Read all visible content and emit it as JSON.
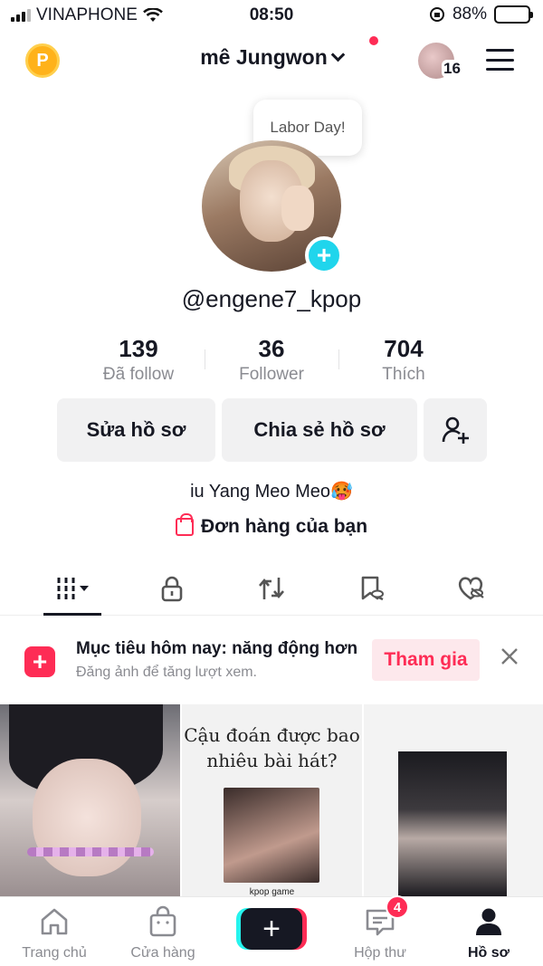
{
  "status_bar": {
    "carrier": "VINAPHONE",
    "time": "08:50",
    "battery_percent": "88%",
    "battery_level": 0.88,
    "battery_color": "#d18b1e"
  },
  "header": {
    "points_label": "P",
    "account_name": "mê Jungwon",
    "story_count": "16"
  },
  "profile": {
    "bubble_text": "Labor Day!",
    "username": "@engene7_kpop",
    "stats": [
      {
        "value": "139",
        "label": "Đã follow"
      },
      {
        "value": "36",
        "label": "Follower"
      },
      {
        "value": "704",
        "label": "Thích"
      }
    ],
    "edit_label": "Sửa hồ sơ",
    "share_label": "Chia sẻ hồ sơ",
    "bio": "iu Yang Meo Meo🥵",
    "orders_label": "Đơn hàng của bạn"
  },
  "tabs": [
    {
      "icon": "grid-icon",
      "active": true
    },
    {
      "icon": "lock-icon",
      "active": false
    },
    {
      "icon": "repost-icon",
      "active": false
    },
    {
      "icon": "bookmark-hidden-icon",
      "active": false
    },
    {
      "icon": "heart-hidden-icon",
      "active": false
    }
  ],
  "goal": {
    "title": "Mục tiêu hôm nay: năng động hơn",
    "subtitle": "Đăng ảnh để tăng lượt xem.",
    "join_label": "Tham gia"
  },
  "videos": [
    {
      "overlay": ""
    },
    {
      "overlay": "Cậu đoán được bao nhiêu bài hát?",
      "caption": "kpop game"
    },
    {
      "overlay": ""
    }
  ],
  "bottom_nav": {
    "home": "Trang chủ",
    "shop": "Cửa hàng",
    "create": "+",
    "inbox": "Hộp thư",
    "inbox_badge": "4",
    "profile": "Hồ sơ"
  },
  "colors": {
    "accent": "#fe2c55",
    "cyan": "#20d5ec"
  }
}
